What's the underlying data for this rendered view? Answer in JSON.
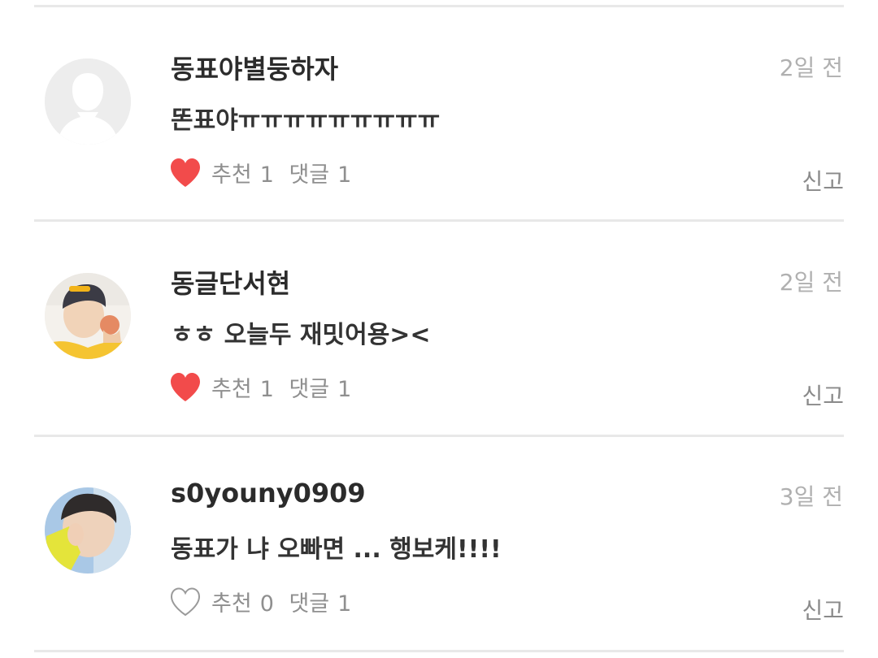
{
  "comments": [
    {
      "author": "동표야별둥하자",
      "time": "2일 전",
      "text": "똔표야ㅠㅠㅠㅠㅠㅠㅠㅠㅠ",
      "like_label": "추천",
      "like_count": "1",
      "reply_label": "댓글",
      "reply_count": "1",
      "liked": true,
      "report_label": "신고",
      "avatar": "default-user-icon"
    },
    {
      "author": "동글단서현",
      "time": "2일 전",
      "text": "ㅎㅎ 오늘두 재밋어용><",
      "like_label": "추천",
      "like_count": "1",
      "reply_label": "댓글",
      "reply_count": "1",
      "liked": true,
      "report_label": "신고",
      "avatar": "user-photo"
    },
    {
      "author": "s0youny0909",
      "time": "3일 전",
      "text": "동표가 냐 오빠면 ... 행보케!!!!",
      "like_label": "추천",
      "like_count": "0",
      "reply_label": "댓글",
      "reply_count": "1",
      "liked": false,
      "report_label": "신고",
      "avatar": "user-photo"
    }
  ],
  "colors": {
    "heart_filled": "#f24b4b",
    "heart_outline": "#9a9a9a",
    "divider": "#e8e8e8",
    "muted_text": "#8f8f8f"
  }
}
